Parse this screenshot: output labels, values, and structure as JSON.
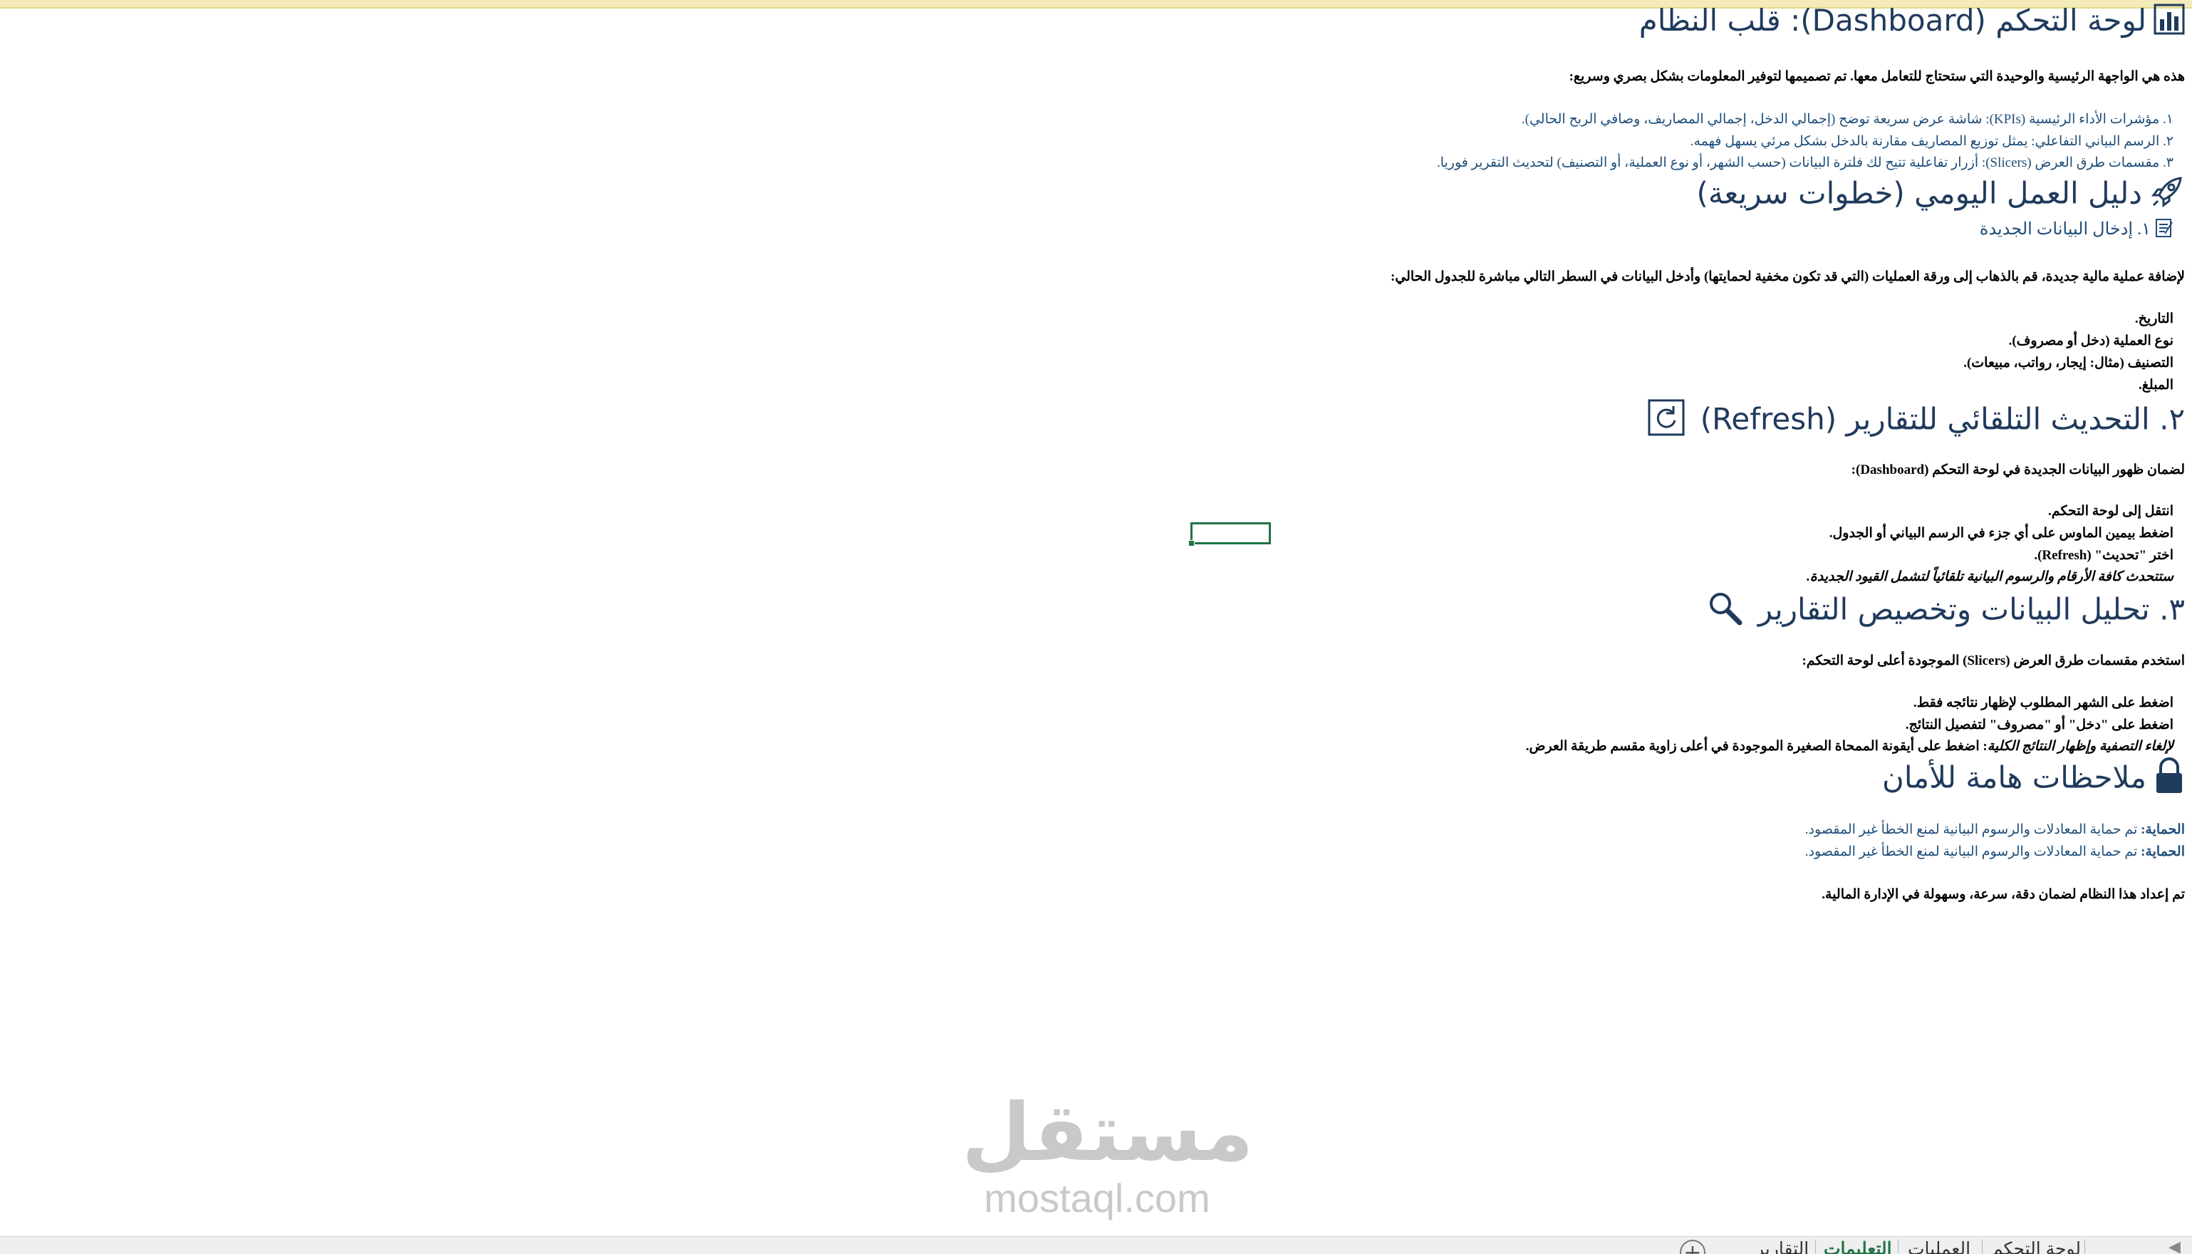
{
  "sections": {
    "dashboard": {
      "title": "لوحة التحكم (Dashboard): قلب النظام",
      "intro": "هذه هي الواجهة الرئيسية والوحيدة التي ستحتاج للتعامل معها. تم تصميمها لتوفير المعلومات بشكل بصري وسريع:",
      "items": [
        "١. مؤشرات الأداء الرئيسية (KPIs): شاشة عرض سريعة توضح (إجمالي الدخل، إجمالي المصاريف، وصافي الربح الحالي).",
        "٢. الرسم البياني التفاعلي: يمثل توزيع المصاريف مقارنة بالدخل بشكل مرئي يسهل فهمه.",
        "٣. مقسمات طرق العرض (Slicers): أزرار تفاعلية تتيح لك فلترة البيانات (حسب الشهر، أو نوع العملية، أو التصنيف) لتحديث التقرير فوريا."
      ]
    },
    "daily_guide": {
      "title": "دليل العمل اليومي (خطوات سريعة)",
      "subtitle": "١. إدخال البيانات الجديدة",
      "intro": "لإضافة عملية مالية جديدة، قم بالذهاب إلى ورقة العمليات (التي قد تكون مخفية لحمايتها) وأدخل البيانات في السطر التالي مباشرة للجدول الحالي:",
      "fields": [
        "التاريخ.",
        "نوع العملية (دخل أو مصروف).",
        "التصنيف (مثال: إيجار، رواتب، مبيعات).",
        "المبلغ."
      ]
    },
    "refresh": {
      "title": "٢. التحديث التلقائي للتقارير (Refresh)",
      "intro": "لضمان ظهور البيانات الجديدة في لوحة التحكم (Dashboard):",
      "steps": [
        "انتقل إلى لوحة التحكم.",
        "اضغط بيمين الماوس على أي جزء في الرسم البياني أو الجدول.",
        "اختر \"تحديث\" (Refresh)."
      ],
      "note": "ستتحدث كافة الأرقام والرسوم البيانية تلقائياً لتشمل القيود الجديدة."
    },
    "analysis": {
      "title": "٣. تحليل البيانات وتخصيص التقارير",
      "intro": "استخدم مقسمات طرق العرض (Slicers) الموجودة أعلى لوحة التحكم:",
      "steps": [
        "اضغط على الشهر المطلوب لإظهار نتائجه فقط.",
        "اضغط على \"دخل\" أو \"مصروف\" لتفصيل النتائج."
      ],
      "clear_label": "لإلغاء التصفية وإظهار النتائج الكلية",
      "clear_text": ": اضغط على أيقونة الممحاة الصغيرة الموجودة في أعلى زاوية مقسم طريقة العرض."
    },
    "security": {
      "title": "ملاحظات هامة للأمان",
      "notes": [
        {
          "label": "الحماية:",
          "text": " تم حماية المعادلات والرسوم البيانية لمنع الخطأ غير المقصود."
        },
        {
          "label": "الحماية:",
          "text": " تم حماية المعادلات والرسوم البيانية لمنع الخطأ غير المقصود."
        }
      ],
      "closing": "تم إعداد هذا النظام لضمان دقة، سرعة، وسهولة في الإدارة المالية."
    }
  },
  "watermark": {
    "arabic": "مستقل",
    "latin": "mostaql.com"
  },
  "sheet_tabs": [
    {
      "label": "لوحة التحكم",
      "active": false
    },
    {
      "label": "العمليات",
      "active": false
    },
    {
      "label": "التعليمات",
      "active": true
    },
    {
      "label": "التقارير",
      "active": false
    }
  ],
  "icons": {
    "dashboard": "bar-chart-icon",
    "daily_guide": "rocket-icon",
    "subtitle": "memo-icon",
    "refresh": "refresh-icon",
    "analysis": "magnifier-icon",
    "security": "lock-icon"
  },
  "colors": {
    "heading": "#1f3a5c",
    "link_text": "#1f4e79",
    "selection": "#217346"
  }
}
